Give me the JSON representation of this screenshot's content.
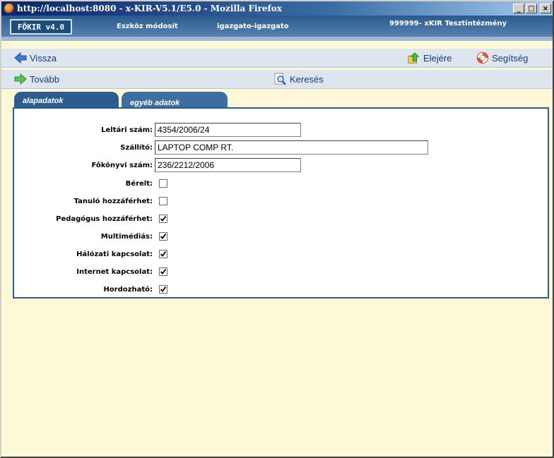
{
  "window": {
    "title": "http://localhost:8080 - x-KIR-V5.1/E5.0 - Mozilla Firefox",
    "min_label": "_",
    "max_label": "□",
    "close_label": "×"
  },
  "header": {
    "logo": "FŐKIR v4.0",
    "function": "Eszköz módosít",
    "user": "igazgato-igazgato",
    "institution": "999999- xKIR Tesztintézmény"
  },
  "toolbar1": {
    "back": "Vissza",
    "top": "Elejére",
    "help": "Segítség"
  },
  "toolbar2": {
    "next": "Tovább",
    "search": "Keresés"
  },
  "tabs": [
    {
      "label": "alapadatok",
      "active": false
    },
    {
      "label": "egyéb adatok",
      "active": true
    }
  ],
  "form": {
    "leltari": {
      "label": "Leltári szám:",
      "value": "4354/2006/24"
    },
    "szallito": {
      "label": "Szállító:",
      "value": "LAPTOP COMP RT."
    },
    "fokonyvi": {
      "label": "Főkönyvi szám:",
      "value": "236/2212/2006"
    },
    "checkboxes": [
      {
        "label": "Bérelt:",
        "checked": false
      },
      {
        "label": "Tanuló hozzáférhet:",
        "checked": false
      },
      {
        "label": "Pedagógus hozzáférhet:",
        "checked": true
      },
      {
        "label": "Multimédiás:",
        "checked": true
      },
      {
        "label": "Hálózati kapcsolat:",
        "checked": true
      },
      {
        "label": "Internet kapcsolat:",
        "checked": true
      },
      {
        "label": "Hordozható:",
        "checked": true
      }
    ]
  }
}
